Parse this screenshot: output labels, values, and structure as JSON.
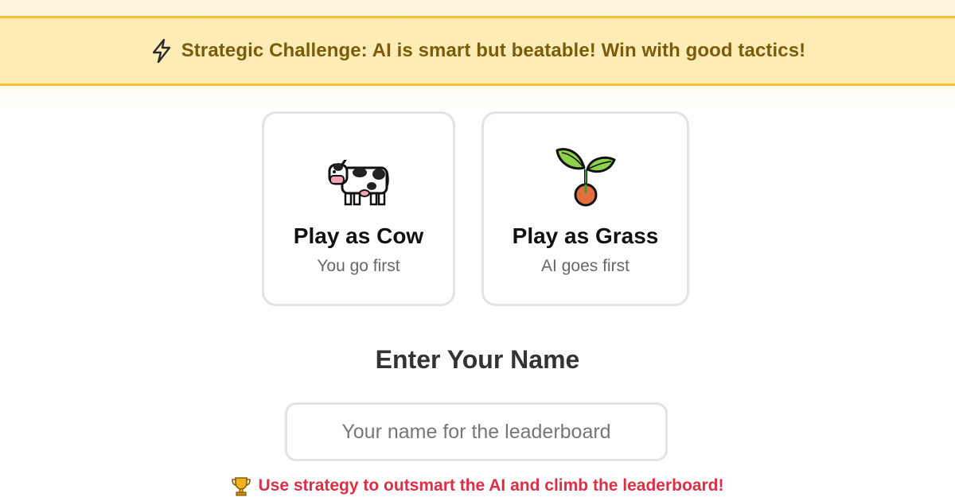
{
  "banner": {
    "icon": "lightning-bolt-icon",
    "text": "Strategic Challenge: AI is smart but beatable! Win with good tactics!",
    "colors": {
      "background": "#fdecb4",
      "border": "#f6c12a",
      "text": "#7a5c0c"
    }
  },
  "roles": [
    {
      "icon": "cow-icon",
      "title": "Play as Cow",
      "subtitle": "You go first"
    },
    {
      "icon": "seedling-icon",
      "title": "Play as Grass",
      "subtitle": "AI goes first"
    }
  ],
  "name_section": {
    "heading": "Enter Your Name",
    "placeholder": "Your name for the leaderboard",
    "value": ""
  },
  "hint": {
    "icon": "trophy-icon",
    "text": "Use strategy to outsmart the AI and climb the leaderboard!",
    "color": "#dc2f45"
  }
}
